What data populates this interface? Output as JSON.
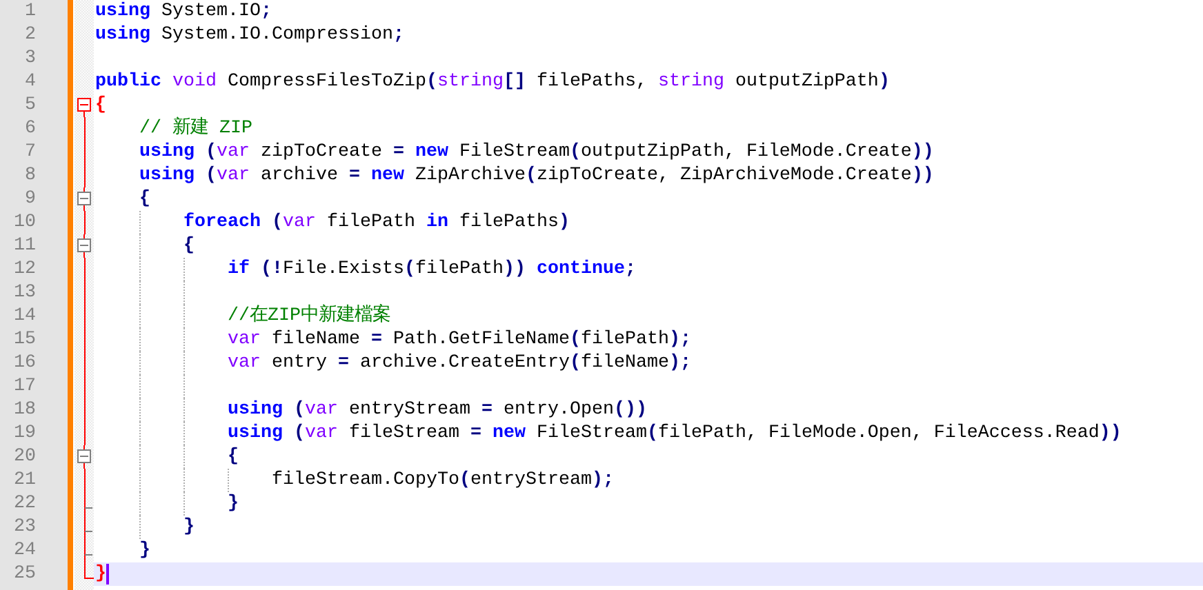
{
  "editor": {
    "lines": [
      {
        "number": "1",
        "current": false,
        "tokens": [
          {
            "kind": "kw",
            "text": "using"
          },
          {
            "kind": "text",
            "text": " System.IO"
          },
          {
            "kind": "op",
            "text": ";"
          }
        ]
      },
      {
        "number": "2",
        "current": false,
        "tokens": [
          {
            "kind": "kw",
            "text": "using"
          },
          {
            "kind": "text",
            "text": " System.IO.Compression"
          },
          {
            "kind": "op",
            "text": ";"
          }
        ]
      },
      {
        "number": "3",
        "current": false
      },
      {
        "number": "4",
        "current": false,
        "tokens": [
          {
            "kind": "kw",
            "text": "public"
          },
          {
            "kind": "type",
            "text": " void"
          },
          {
            "kind": "text",
            "text": " CompressFilesToZip"
          },
          {
            "kind": "op",
            "text": "("
          },
          {
            "kind": "type",
            "text": "string"
          },
          {
            "kind": "op",
            "text": "[]"
          },
          {
            "kind": "text",
            "text": " filePaths,"
          },
          {
            "kind": "type",
            "text": " string"
          },
          {
            "kind": "text",
            "text": " outputZipPath"
          },
          {
            "kind": "op",
            "text": ")"
          }
        ]
      },
      {
        "number": "5",
        "current": false,
        "fold": {
          "kind": "head"
        },
        "tokens": [
          {
            "kind": "match",
            "text": "{"
          }
        ]
      },
      {
        "number": "6",
        "current": false,
        "fold": {
          "kind": "line"
        },
        "tokens": [
          {
            "kind": "comment",
            "text": "    // 新建 ZIP"
          }
        ]
      },
      {
        "number": "7",
        "current": false,
        "fold": {
          "kind": "line"
        },
        "tokens": [
          {
            "kind": "kw",
            "text": "    using"
          },
          {
            "kind": "op",
            "text": " ("
          },
          {
            "kind": "type",
            "text": "var"
          },
          {
            "kind": "text",
            "text": " zipToCreate"
          },
          {
            "kind": "op",
            "text": " ="
          },
          {
            "kind": "kw",
            "text": " new"
          },
          {
            "kind": "text",
            "text": " FileStream"
          },
          {
            "kind": "op",
            "text": "("
          },
          {
            "kind": "text",
            "text": "outputZipPath, FileMode.Create"
          },
          {
            "kind": "op",
            "text": "))"
          }
        ]
      },
      {
        "number": "8",
        "current": false,
        "fold": {
          "kind": "line"
        },
        "tokens": [
          {
            "kind": "kw",
            "text": "    using"
          },
          {
            "kind": "op",
            "text": " ("
          },
          {
            "kind": "type",
            "text": "var"
          },
          {
            "kind": "text",
            "text": " archive"
          },
          {
            "kind": "op",
            "text": " ="
          },
          {
            "kind": "kw",
            "text": " new"
          },
          {
            "kind": "text",
            "text": " ZipArchive"
          },
          {
            "kind": "op",
            "text": "("
          },
          {
            "kind": "text",
            "text": "zipToCreate, ZipArchiveMode.Create"
          },
          {
            "kind": "op",
            "text": "))"
          }
        ]
      },
      {
        "number": "9",
        "current": false,
        "fold": {
          "kind": "box"
        },
        "tokens": [
          {
            "kind": "op",
            "text": "    {"
          }
        ]
      },
      {
        "number": "10",
        "current": false,
        "fold": {
          "kind": "line"
        },
        "tokens": [
          {
            "kind": "kw",
            "text": "        foreach"
          },
          {
            "kind": "op",
            "text": " ("
          },
          {
            "kind": "type",
            "text": "var"
          },
          {
            "kind": "text",
            "text": " filePath"
          },
          {
            "kind": "kw",
            "text": " in"
          },
          {
            "kind": "text",
            "text": " filePaths"
          },
          {
            "kind": "op",
            "text": ")"
          }
        ]
      },
      {
        "number": "11",
        "current": false,
        "fold": {
          "kind": "box"
        },
        "tokens": [
          {
            "kind": "op",
            "text": "        {"
          }
        ]
      },
      {
        "number": "12",
        "current": false,
        "fold": {
          "kind": "line"
        },
        "tokens": [
          {
            "kind": "kw",
            "text": "            if"
          },
          {
            "kind": "op",
            "text": " (!"
          },
          {
            "kind": "text",
            "text": "File.Exists"
          },
          {
            "kind": "op",
            "text": "("
          },
          {
            "kind": "text",
            "text": "filePath"
          },
          {
            "kind": "op",
            "text": "))"
          },
          {
            "kind": "kw",
            "text": " continue"
          },
          {
            "kind": "op",
            "text": ";"
          }
        ]
      },
      {
        "number": "13",
        "current": false,
        "fold": {
          "kind": "line"
        }
      },
      {
        "number": "14",
        "current": false,
        "fold": {
          "kind": "line"
        },
        "tokens": [
          {
            "kind": "comment",
            "text": "            //在ZIP中新建檔案"
          }
        ]
      },
      {
        "number": "15",
        "current": false,
        "fold": {
          "kind": "line"
        },
        "tokens": [
          {
            "kind": "type",
            "text": "            var"
          },
          {
            "kind": "text",
            "text": " fileName"
          },
          {
            "kind": "op",
            "text": " ="
          },
          {
            "kind": "text",
            "text": " Path.GetFileName"
          },
          {
            "kind": "op",
            "text": "("
          },
          {
            "kind": "text",
            "text": "filePath"
          },
          {
            "kind": "op",
            "text": ");"
          }
        ]
      },
      {
        "number": "16",
        "current": false,
        "fold": {
          "kind": "line"
        },
        "tokens": [
          {
            "kind": "type",
            "text": "            var"
          },
          {
            "kind": "text",
            "text": " entry"
          },
          {
            "kind": "op",
            "text": " ="
          },
          {
            "kind": "text",
            "text": " archive.CreateEntry"
          },
          {
            "kind": "op",
            "text": "("
          },
          {
            "kind": "text",
            "text": "fileName"
          },
          {
            "kind": "op",
            "text": ");"
          }
        ]
      },
      {
        "number": "17",
        "current": false,
        "fold": {
          "kind": "line"
        }
      },
      {
        "number": "18",
        "current": false,
        "fold": {
          "kind": "line"
        },
        "tokens": [
          {
            "kind": "kw",
            "text": "            using"
          },
          {
            "kind": "op",
            "text": " ("
          },
          {
            "kind": "type",
            "text": "var"
          },
          {
            "kind": "text",
            "text": " entryStream"
          },
          {
            "kind": "op",
            "text": " ="
          },
          {
            "kind": "text",
            "text": " entry.Open"
          },
          {
            "kind": "op",
            "text": "())"
          }
        ]
      },
      {
        "number": "19",
        "current": false,
        "fold": {
          "kind": "line"
        },
        "tokens": [
          {
            "kind": "kw",
            "text": "            using"
          },
          {
            "kind": "op",
            "text": " ("
          },
          {
            "kind": "type",
            "text": "var"
          },
          {
            "kind": "text",
            "text": " fileStream"
          },
          {
            "kind": "op",
            "text": " ="
          },
          {
            "kind": "kw",
            "text": " new"
          },
          {
            "kind": "text",
            "text": " FileStream"
          },
          {
            "kind": "op",
            "text": "("
          },
          {
            "kind": "text",
            "text": "filePath, FileMode.Open, FileAccess.Read"
          },
          {
            "kind": "op",
            "text": "))"
          }
        ]
      },
      {
        "number": "20",
        "current": false,
        "fold": {
          "kind": "box"
        },
        "tokens": [
          {
            "kind": "op",
            "text": "            {"
          }
        ]
      },
      {
        "number": "21",
        "current": false,
        "fold": {
          "kind": "line"
        },
        "tokens": [
          {
            "kind": "text",
            "text": "                fileStream.CopyTo"
          },
          {
            "kind": "op",
            "text": "("
          },
          {
            "kind": "text",
            "text": "entryStream"
          },
          {
            "kind": "op",
            "text": ");"
          }
        ]
      },
      {
        "number": "22",
        "current": false,
        "fold": {
          "kind": "tick"
        },
        "tokens": [
          {
            "kind": "op",
            "text": "            }"
          }
        ]
      },
      {
        "number": "23",
        "current": false,
        "fold": {
          "kind": "tick"
        },
        "tokens": [
          {
            "kind": "op",
            "text": "        }"
          }
        ]
      },
      {
        "number": "24",
        "current": false,
        "fold": {
          "kind": "tick"
        },
        "tokens": [
          {
            "kind": "op",
            "text": "    }"
          }
        ]
      },
      {
        "number": "25",
        "current": true,
        "fold": {
          "kind": "end"
        },
        "tokens": [
          {
            "kind": "match",
            "text": "}"
          }
        ]
      }
    ]
  }
}
